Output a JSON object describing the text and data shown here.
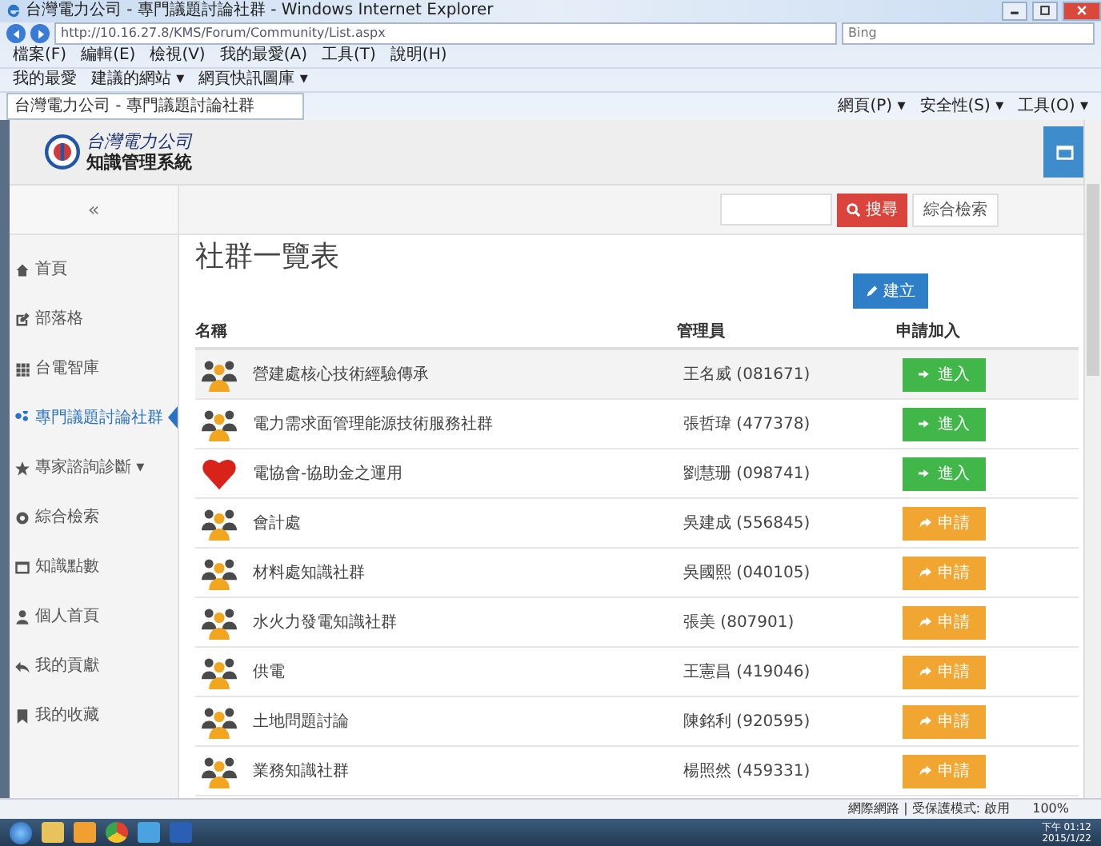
{
  "browser": {
    "title": "台灣電力公司 - 專門議題討論社群 - Windows Internet Explorer",
    "address": "http://10.16.27.8/KMS/Forum/Community/List.aspx",
    "search_engine": "Bing",
    "menu": [
      "檔案(F)",
      "編輯(E)",
      "檢視(V)",
      "我的最愛(A)",
      "工具(T)",
      "說明(H)"
    ],
    "favorites": [
      "我的最愛",
      "建議的網站 ▾",
      "網頁快訊圖庫 ▾"
    ],
    "tab": "台灣電力公司 - 專門議題討論社群",
    "commands": [
      "網頁(P) ▾",
      "安全性(S) ▾",
      "工具(O) ▾"
    ]
  },
  "header": {
    "company": "台灣電力公司",
    "system": "知識管理系統"
  },
  "collapse": "«",
  "search": {
    "button": "搜尋",
    "advanced": "綜合檢索"
  },
  "sidebar": [
    {
      "label": "首頁",
      "selected": false
    },
    {
      "label": "部落格",
      "selected": false
    },
    {
      "label": "台電智庫",
      "selected": false
    },
    {
      "label": "專門議題討論社群",
      "selected": true
    },
    {
      "label": "專家諮詢診斷 ▾",
      "selected": false
    },
    {
      "label": "綜合檢索",
      "selected": false
    },
    {
      "label": "知識點數",
      "selected": false
    },
    {
      "label": "個人首頁",
      "selected": false
    },
    {
      "label": "我的貢獻",
      "selected": false
    },
    {
      "label": "我的收藏",
      "selected": false
    }
  ],
  "page_title": "社群一覽表",
  "create_button": "建立",
  "table": {
    "columns": [
      "名稱",
      "管理員",
      "申請加入"
    ],
    "rows": [
      {
        "kind": "group",
        "name": "營建處核心技術經驗傳承",
        "manager": "王名威 (081671)",
        "action": {
          "kind": "enter",
          "label": "進入"
        },
        "selected": true
      },
      {
        "kind": "group",
        "name": "電力需求面管理能源技術服務社群",
        "manager": "張哲瑋 (477378)",
        "action": {
          "kind": "enter",
          "label": "進入"
        },
        "selected": false
      },
      {
        "kind": "heart",
        "name": "電協會-協助金之運用",
        "manager": "劉慧珊 (098741)",
        "action": {
          "kind": "enter",
          "label": "進入"
        },
        "selected": false
      },
      {
        "kind": "group",
        "name": "會計處",
        "manager": "吳建成 (556845)",
        "action": {
          "kind": "apply",
          "label": "申請"
        },
        "selected": false
      },
      {
        "kind": "group",
        "name": "材料處知識社群",
        "manager": "吳國熙 (040105)",
        "action": {
          "kind": "apply",
          "label": "申請"
        },
        "selected": false
      },
      {
        "kind": "group",
        "name": "水火力發電知識社群",
        "manager": "張美 (807901)",
        "action": {
          "kind": "apply",
          "label": "申請"
        },
        "selected": false
      },
      {
        "kind": "group",
        "name": "供電",
        "manager": "王憲昌 (419046)",
        "action": {
          "kind": "apply",
          "label": "申請"
        },
        "selected": false
      },
      {
        "kind": "group",
        "name": "土地問題討論",
        "manager": "陳銘利 (920595)",
        "action": {
          "kind": "apply",
          "label": "申請"
        },
        "selected": false
      },
      {
        "kind": "group",
        "name": "業務知識社群",
        "manager": "楊照然 (459331)",
        "action": {
          "kind": "apply",
          "label": "申請"
        },
        "selected": false
      }
    ]
  },
  "status_bar": {
    "zone": "網際網路 | 受保護模式: 啟用",
    "zoom": "100%"
  },
  "taskbar": {
    "time": "下午 01:12",
    "date": "2015/1/22"
  }
}
